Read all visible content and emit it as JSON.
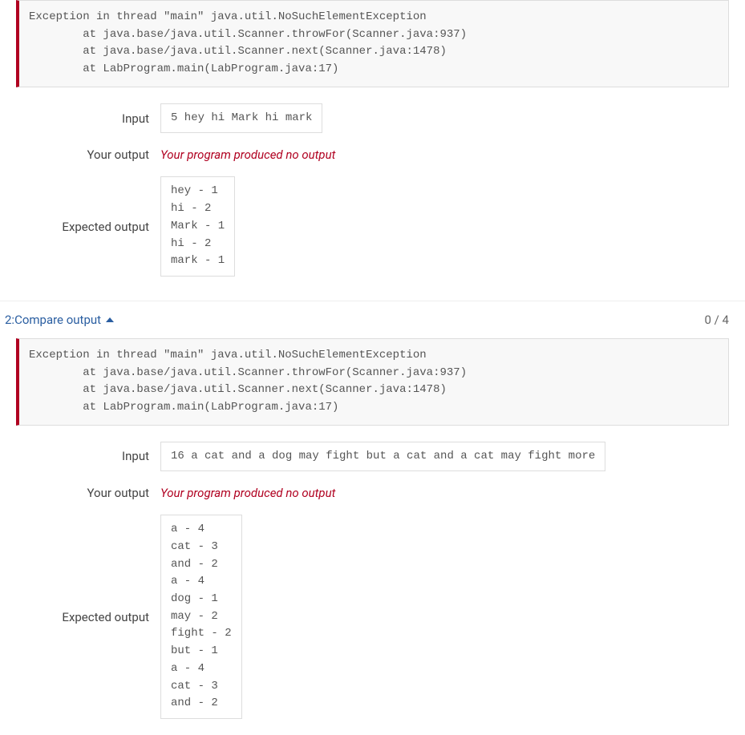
{
  "test1": {
    "exception": "Exception in thread \"main\" java.util.NoSuchElementException\n        at java.base/java.util.Scanner.throwFor(Scanner.java:937)\n        at java.base/java.util.Scanner.next(Scanner.java:1478)\n        at LabProgram.main(LabProgram.java:17)",
    "labels": {
      "input": "Input",
      "your_output": "Your output",
      "expected_output": "Expected output"
    },
    "input": "5 hey hi Mark hi mark",
    "your_output": "Your program produced no output",
    "expected_output": "hey - 1\nhi - 2\nMark - 1\nhi - 2\nmark - 1"
  },
  "test2": {
    "header": "2:Compare output",
    "score": "0 / 4",
    "exception": "Exception in thread \"main\" java.util.NoSuchElementException\n        at java.base/java.util.Scanner.throwFor(Scanner.java:937)\n        at java.base/java.util.Scanner.next(Scanner.java:1478)\n        at LabProgram.main(LabProgram.java:17)",
    "labels": {
      "input": "Input",
      "your_output": "Your output",
      "expected_output": "Expected output"
    },
    "input": "16 a cat and a dog may fight but a cat and a cat may fight more",
    "your_output": "Your program produced no output",
    "expected_output": "a - 4\ncat - 3\nand - 2\na - 4\ndog - 1\nmay - 2\nfight - 2\nbut - 1\na - 4\ncat - 3\nand - 2"
  }
}
